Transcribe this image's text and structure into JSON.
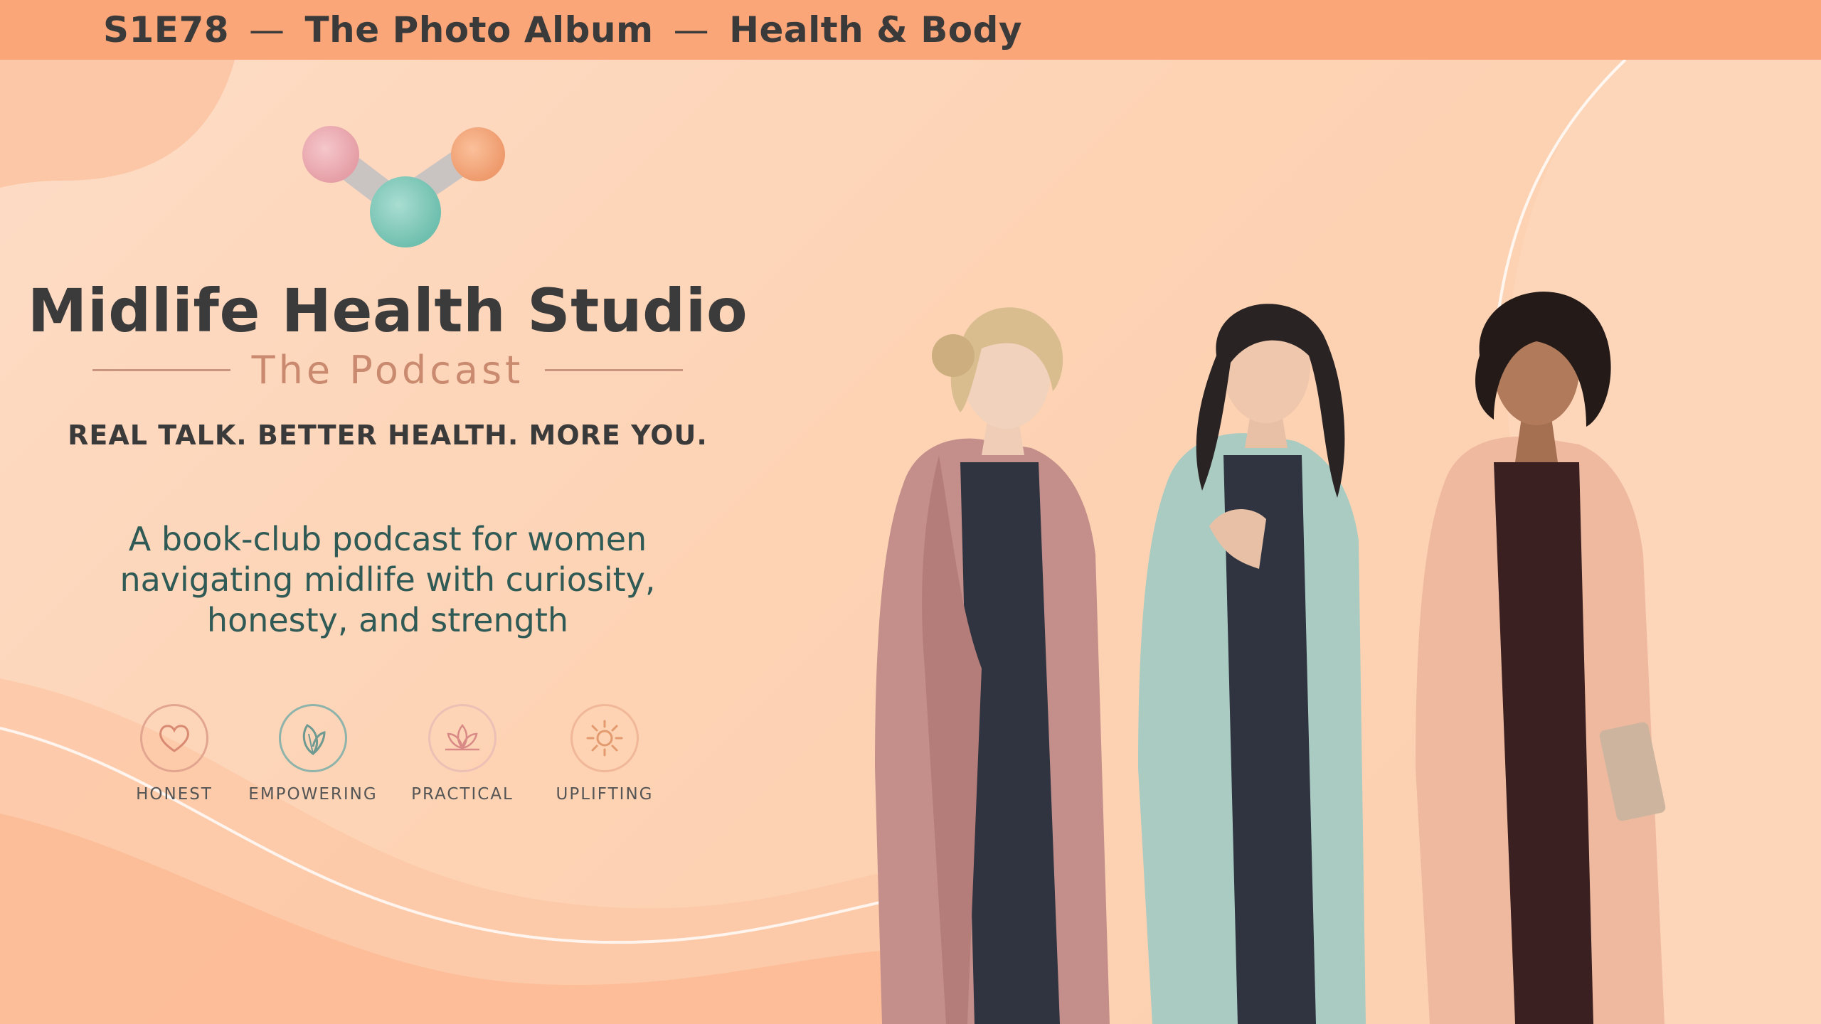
{
  "episode_bar": {
    "episode": "S1E78",
    "separator": "—",
    "episode_title": "The Photo Album",
    "category": "Health & Body"
  },
  "brand": {
    "title": "Midlife Health Studio",
    "subtitle": "The Podcast",
    "tagline": "REAL TALK. BETTER HEALTH. MORE YOU.",
    "description": "A book-club podcast for women navigating midlife with curiosity, honesty, and strength"
  },
  "values": [
    {
      "label": "HONEST",
      "icon": "heart-icon",
      "color": "#d98a72"
    },
    {
      "label": "EMPOWERING",
      "icon": "leaf-icon",
      "color": "#6f9a92"
    },
    {
      "label": "PRACTICAL",
      "icon": "lotus-icon",
      "color": "#d98a86"
    },
    {
      "label": "UPLIFTING",
      "icon": "sun-icon",
      "color": "#e39a6e"
    }
  ],
  "colors": {
    "bar": "#fba678",
    "background": "#fdd6ba",
    "title_text": "#3b3b3b",
    "subtitle_text": "#c98a70",
    "description_text": "#2f5a55",
    "coat_mauve": "#c48f8a",
    "coat_sage": "#a9cbc2",
    "coat_peach": "#efb99f"
  }
}
